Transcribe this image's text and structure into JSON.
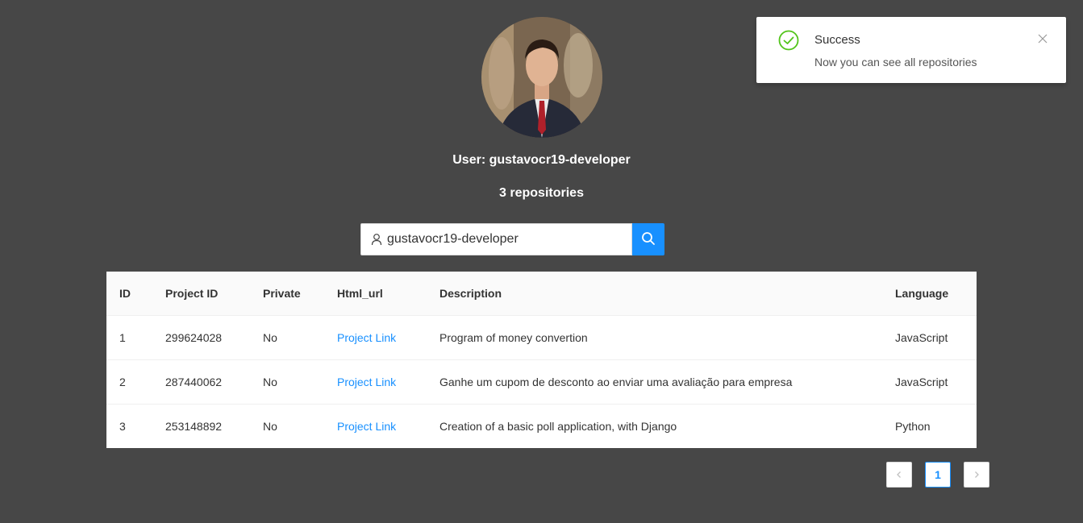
{
  "profile": {
    "user_line": "User: gustavocr19-developer",
    "repo_count_line": "3 repositories"
  },
  "search": {
    "value": "gustavocr19-developer",
    "user_icon": "user-icon",
    "button_icon": "search-icon"
  },
  "table": {
    "columns": [
      "ID",
      "Project ID",
      "Private",
      "Html_url",
      "Description",
      "Language"
    ],
    "rows": [
      {
        "id": "1",
        "project_id": "299624028",
        "private": "No",
        "link": "Project Link",
        "description": "Program of money convertion",
        "language": "JavaScript"
      },
      {
        "id": "2",
        "project_id": "287440062",
        "private": "No",
        "link": "Project Link",
        "description": "Ganhe um cupom de desconto ao enviar uma avaliação para empresa",
        "language": "JavaScript"
      },
      {
        "id": "3",
        "project_id": "253148892",
        "private": "No",
        "link": "Project Link",
        "description": "Creation of a basic poll application, with Django",
        "language": "Python"
      }
    ]
  },
  "pagination": {
    "prev_icon": "chevron-left-icon",
    "current_page": "1",
    "next_icon": "chevron-right-icon"
  },
  "notification": {
    "title": "Success",
    "message": "Now you can see all repositories",
    "icon": "check-circle-icon",
    "close_icon": "close-icon"
  },
  "colors": {
    "background": "#474747",
    "accent": "#1890ff",
    "success": "#52c41a"
  }
}
